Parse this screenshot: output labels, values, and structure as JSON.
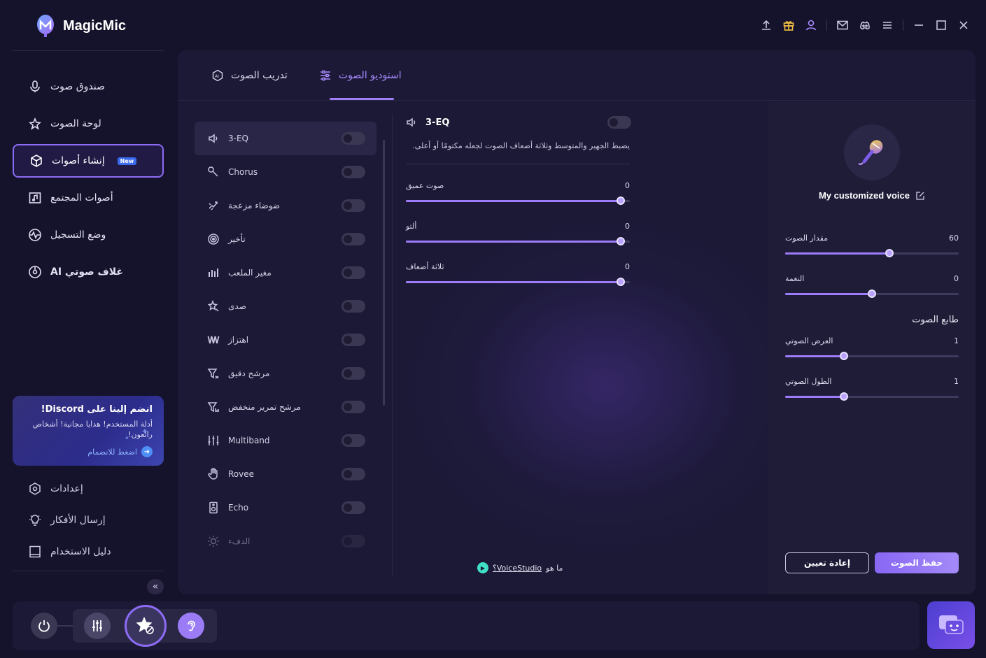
{
  "app": {
    "title": "MagicMic"
  },
  "topbar": {
    "icons": [
      "upload-icon",
      "gift-icon",
      "user-icon",
      "mail-icon",
      "discord-icon",
      "menu-icon",
      "minimize-icon",
      "maximize-icon",
      "close-icon"
    ]
  },
  "sidebar": {
    "items": [
      {
        "label": "صندوق صوت",
        "icon": "microphone-icon"
      },
      {
        "label": "لوحة الصوت",
        "icon": "sparkle-star-icon"
      },
      {
        "label": "إنشاء أصوات",
        "icon": "cube-icon",
        "badge": "New",
        "active": true
      },
      {
        "label": "أصوات المجتمع",
        "icon": "folder-music-icon"
      },
      {
        "label": "وضع التسجيل",
        "icon": "waveform-circle-icon"
      },
      {
        "label": "AI غلاف صوتي",
        "icon": "vinyl-icon"
      }
    ],
    "discord": {
      "title": "انضم إلينا على Discord!",
      "text": "أدلة المستخدم! هدايا مجانية! أشخاص رائعون!",
      "link": "اضغط للانضمام"
    },
    "bottom_items": [
      {
        "label": "إعدادات",
        "icon": "settings-icon"
      },
      {
        "label": "إرسال الأفكار",
        "icon": "lightbulb-icon"
      },
      {
        "label": "دليل الاستخدام",
        "icon": "guide-book-icon"
      }
    ],
    "collapse": "«"
  },
  "main": {
    "tabs": [
      {
        "label": "تدريب الصوت",
        "icon": "ai-badge-icon"
      },
      {
        "label": "استوديو الصوت",
        "icon": "sliders-icon",
        "active": true
      }
    ],
    "effects": [
      {
        "label": "3-EQ",
        "icon": "speaker-icon",
        "selected": true
      },
      {
        "label": "Chorus",
        "icon": "microphone-tilt-icon"
      },
      {
        "label": "ضوضاء مزعجة",
        "icon": "noise-icon"
      },
      {
        "label": "تأخير",
        "icon": "delay-icon"
      },
      {
        "label": "مغير الملعب",
        "icon": "bars-icon"
      },
      {
        "label": "صدى",
        "icon": "echo-star-icon"
      },
      {
        "label": "اهتزاز",
        "icon": "vibrato-icon"
      },
      {
        "label": "مرشح دقيق",
        "icon": "filter-icon"
      },
      {
        "label": "مرشح تمرير منخفض",
        "icon": "lowpass-filter-icon"
      },
      {
        "label": "Multiband",
        "icon": "multiband-icon"
      },
      {
        "label": "Rovee",
        "icon": "hand-icon"
      },
      {
        "label": "Echo",
        "icon": "speaker-box-icon"
      },
      {
        "label": "الدفء",
        "icon": "sun-icon",
        "faded": true
      }
    ],
    "detail": {
      "title": "3-EQ",
      "description": "يضبط الجهير والمتوسط وثلاثة أضعاف الصوت لجعله مكتومًا أو أعلى.",
      "sliders": [
        {
          "label": "صوت عميق",
          "value": "0",
          "fraction": 0.96
        },
        {
          "label": "ألتو",
          "value": "0",
          "fraction": 0.96
        },
        {
          "label": "ثلاثة أضعاف",
          "value": "0",
          "fraction": 0.96
        }
      ],
      "help_prefix": "ما هو",
      "help_link": "VoiceStudio؟"
    },
    "voice_panel": {
      "name": "My customized voice",
      "sliders": [
        {
          "label": "مقدار الصوت",
          "value": "60",
          "fraction": 0.6
        },
        {
          "label": "النغمة",
          "value": "0",
          "fraction": 0.5
        }
      ],
      "section_title": "طابع الصوت",
      "timbre_sliders": [
        {
          "label": "العرض الصوتي",
          "value": "1",
          "fraction": 0.34
        },
        {
          "label": "الطول الصوتي",
          "value": "1",
          "fraction": 0.34
        }
      ],
      "reset_label": "إعادة تعيين",
      "save_label": "حفظ الصوت"
    }
  },
  "bottom_bar": {
    "buttons": [
      "power-icon",
      "mixer-icon",
      "voice-effect-icon",
      "ear-icon"
    ]
  },
  "colors": {
    "accent": "#9c7cf8",
    "background": "#15122b",
    "panel": "#1c1936"
  }
}
